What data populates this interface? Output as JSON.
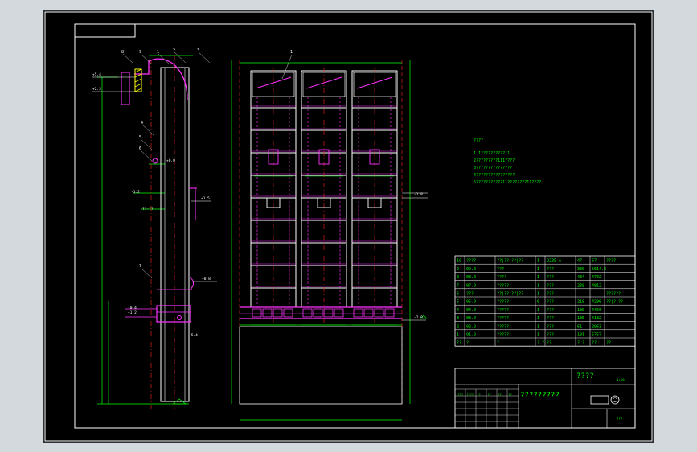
{
  "colors": {
    "background": "#000000",
    "frame": "#ffffff",
    "structure": "#ffffff",
    "pipe": "#ff33ff",
    "dimension": "#00ff00",
    "centerline": "#ff2020",
    "hatch": "#ffff00",
    "canvas_surround": "#d4d9de"
  },
  "notes": {
    "heading": "????",
    "lines": [
      "1.1??????????11",
      "2?????????111????",
      "3???????????????",
      "4????????????????",
      "5???????????11????????11????"
    ]
  },
  "callouts": {
    "side_view": [
      "8",
      "9",
      "1",
      "2",
      "3",
      "4",
      "5",
      "6",
      "7"
    ],
    "front_view": [
      "1"
    ]
  },
  "level_labels": [
    "+5.4",
    "+2.3",
    "+0.0",
    "-1.2",
    "+1.5",
    "??-??",
    "-0.4",
    "+1.2",
    "+8.8",
    "-5.4",
    "-1.8",
    "-2.0"
  ],
  "parts_table": {
    "rows": [
      [
        "10",
        "????",
        "??|??|??|??",
        "1",
        "Q235-A",
        "47",
        "67",
        "????"
      ],
      [
        "9",
        "09.0",
        "???",
        "1",
        "???",
        "380",
        "5614.8",
        ""
      ],
      [
        "8",
        "08.0",
        "????",
        "1",
        "???",
        "434",
        "4702",
        ""
      ],
      [
        "7",
        "07.0",
        "?????",
        "1",
        "???",
        "238",
        "4812",
        ""
      ],
      [
        "6",
        "???",
        "??|??|??|??",
        "1",
        "???",
        "",
        "",
        "??????"
      ],
      [
        "5",
        "05.0",
        "?????",
        "6",
        "???",
        "218",
        "4296",
        "??|?|??"
      ],
      [
        "4",
        "04.0",
        "?????",
        "1",
        "???",
        "180",
        "4456",
        ""
      ],
      [
        "3",
        "03.0",
        "?????",
        "1",
        "???",
        "135",
        "4132",
        ""
      ],
      [
        "2",
        "02.0",
        "?????",
        "1",
        "???",
        "61",
        "2963",
        ""
      ],
      [
        "1",
        "01.0",
        "?????",
        "1",
        "???",
        "191",
        "5757",
        ""
      ]
    ],
    "header": [
      "??",
      "?",
      "?",
      "? ?",
      "??",
      "? ?",
      "??",
      "??"
    ]
  },
  "title_block": {
    "project_title": "????",
    "drawing_name": "?????????",
    "small_labels": [
      "????",
      "????",
      "??",
      "??",
      "??",
      "??"
    ],
    "scale": "1:50",
    "sheet": "???"
  }
}
